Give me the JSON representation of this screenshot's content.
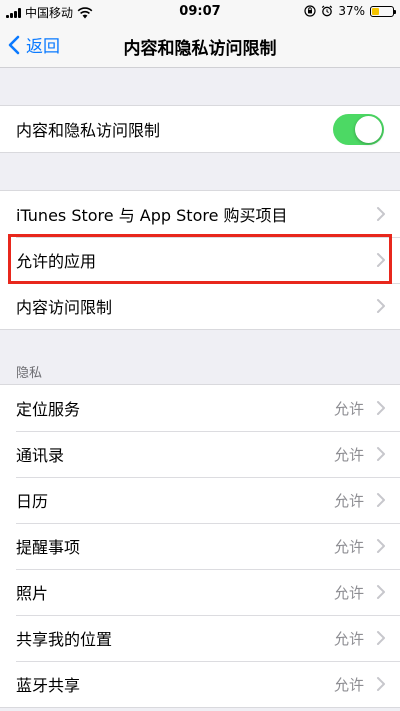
{
  "status_bar": {
    "carrier": "中国移动",
    "time": "09:07",
    "battery_percent": "37%",
    "battery_level": 0.37,
    "battery_color": "#f5c400"
  },
  "nav": {
    "back_label": "返回",
    "title": "内容和隐私访问限制"
  },
  "toggle_row": {
    "label": "内容和隐私访问限制",
    "on": true,
    "on_color": "#4cd964"
  },
  "menu_rows": [
    {
      "label": "iTunes Store 与 App Store 购买项目"
    },
    {
      "label": "允许的应用"
    },
    {
      "label": "内容访问限制"
    }
  ],
  "highlight_color": "#e8271c",
  "privacy": {
    "header": "隐私",
    "rows": [
      {
        "label": "定位服务",
        "value": "允许"
      },
      {
        "label": "通讯录",
        "value": "允许"
      },
      {
        "label": "日历",
        "value": "允许"
      },
      {
        "label": "提醒事项",
        "value": "允许"
      },
      {
        "label": "照片",
        "value": "允许"
      },
      {
        "label": "共享我的位置",
        "value": "允许"
      },
      {
        "label": "蓝牙共享",
        "value": "允许"
      }
    ]
  }
}
